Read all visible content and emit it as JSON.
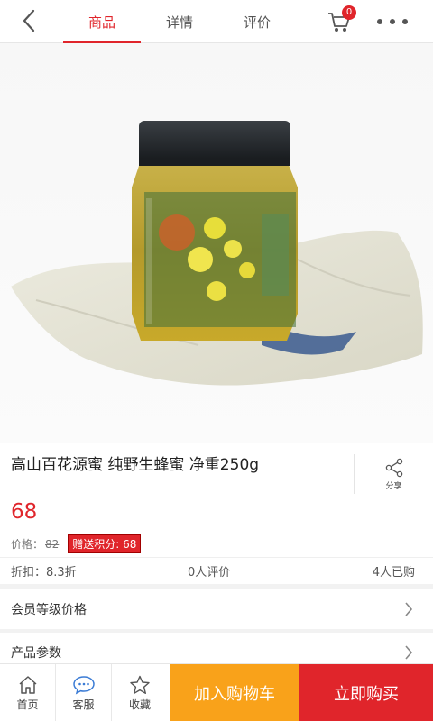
{
  "header": {
    "tabs": [
      {
        "label": "商品",
        "active": true
      },
      {
        "label": "详情",
        "active": false
      },
      {
        "label": "评价",
        "active": false
      }
    ],
    "cart_count": "0"
  },
  "product": {
    "title": "高山百花源蜜 纯野生蜂蜜 净重250g",
    "price": "68",
    "price_label": "价格：",
    "original_price": "82",
    "points_badge": "赠送积分: 68",
    "share_label": "分享",
    "discount": "折扣：8.3折",
    "reviews": "0人评价",
    "sold": "4人已购",
    "carousel": {
      "count": 1,
      "active_index": 0
    }
  },
  "rows": {
    "member_price": "会员等级价格",
    "params": "产品参数"
  },
  "bottom": {
    "home": "首页",
    "service": "客服",
    "favorite": "收藏",
    "add_cart": "加入购物车",
    "buy_now": "立即购买"
  },
  "colors": {
    "accent": "#e0252b",
    "cart_button": "#f9a21a"
  }
}
